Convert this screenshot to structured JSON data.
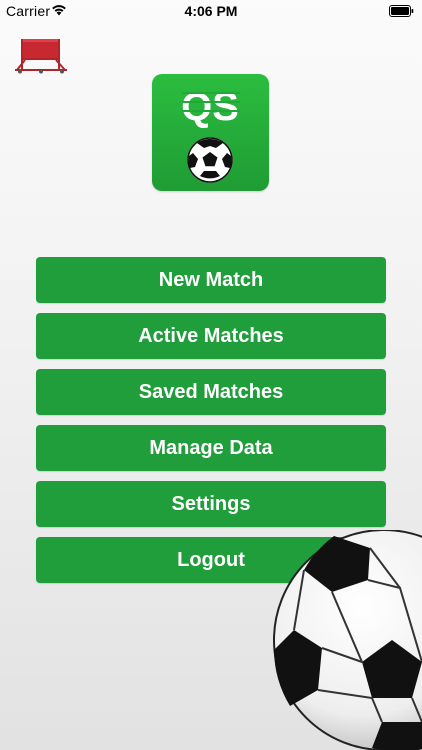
{
  "status_bar": {
    "carrier": "Carrier",
    "time": "4:06 PM",
    "wifi_icon": "wifi-icon",
    "battery_icon": "battery-icon"
  },
  "logo": {
    "text": "QS",
    "icon": "soccer-ball-icon",
    "color": "#22a83a"
  },
  "menu": {
    "items": [
      {
        "label": "New Match"
      },
      {
        "label": "Active Matches"
      },
      {
        "label": "Saved Matches"
      },
      {
        "label": "Manage Data"
      },
      {
        "label": "Settings"
      },
      {
        "label": "Logout"
      }
    ]
  },
  "colors": {
    "button": "#1f9e3b",
    "button_text": "#ffffff",
    "accent_red": "#c8282f"
  }
}
